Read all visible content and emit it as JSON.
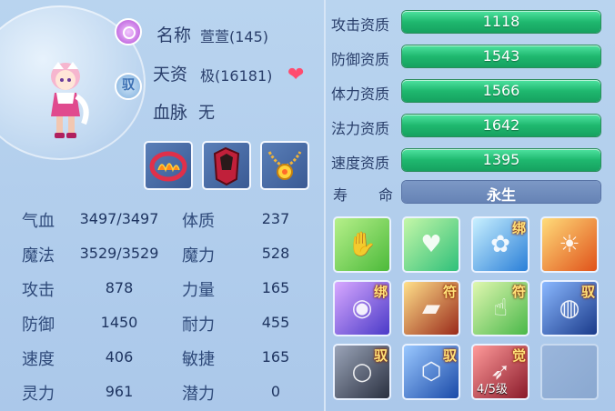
{
  "info": {
    "name_label": "名称",
    "name_value": "萱萱(145)",
    "talent_label": "天资",
    "talent_value": "极(16181)",
    "bloodline_label": "血脉",
    "bloodline_value": "无",
    "ride_badge": "驭"
  },
  "stats": [
    {
      "label": "气血",
      "value": "3497/3497",
      "label2": "体质",
      "value2": "237"
    },
    {
      "label": "魔法",
      "value": "3529/3529",
      "label2": "魔力",
      "value2": "528"
    },
    {
      "label": "攻击",
      "value": "878",
      "label2": "力量",
      "value2": "165"
    },
    {
      "label": "防御",
      "value": "1450",
      "label2": "耐力",
      "value2": "455"
    },
    {
      "label": "速度",
      "value": "406",
      "label2": "敏捷",
      "value2": "165"
    },
    {
      "label": "灵力",
      "value": "961",
      "label2": "潜力",
      "value2": "0"
    }
  ],
  "aptitudes": [
    {
      "label": "攻击资质",
      "value": "1118"
    },
    {
      "label": "防御资质",
      "value": "1543"
    },
    {
      "label": "体力资质",
      "value": "1566"
    },
    {
      "label": "法力资质",
      "value": "1642"
    },
    {
      "label": "速度资质",
      "value": "1395"
    }
  ],
  "life": {
    "label1": "寿",
    "label2": "命",
    "value": "永生"
  },
  "skills": [
    {
      "icon": "healing-hand-icon",
      "tag": ""
    },
    {
      "icon": "heart-shield-icon",
      "tag": ""
    },
    {
      "icon": "swirl-petal-icon",
      "tag": "绑"
    },
    {
      "icon": "fireball-icon",
      "tag": ""
    },
    {
      "icon": "purple-vortex-icon",
      "tag": "绑"
    },
    {
      "icon": "golden-scroll-icon",
      "tag": "符"
    },
    {
      "icon": "pointing-hand-icon",
      "tag": "符"
    },
    {
      "icon": "water-orb-icon",
      "tag": "驭"
    },
    {
      "icon": "bubbles-icon",
      "tag": "驭"
    },
    {
      "icon": "shield-wave-icon",
      "tag": "驭"
    },
    {
      "icon": "red-strike-icon",
      "tag": "觉",
      "level": "4/5级"
    },
    {
      "icon": "empty-slot",
      "tag": ""
    }
  ],
  "colors": {
    "bar_green": "#1fb86f",
    "life_bar": "#6683b5",
    "text": "#2a3f6b"
  }
}
